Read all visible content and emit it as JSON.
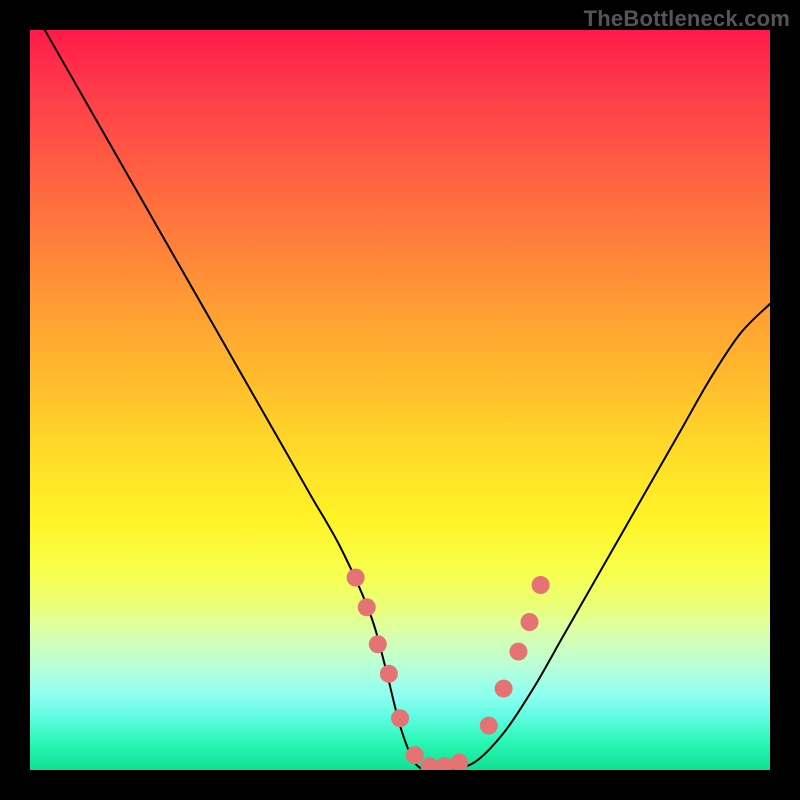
{
  "watermark": "TheBottleneck.com",
  "colors": {
    "curve_stroke": "#000000",
    "marker_fill": "#e57373",
    "marker_stroke": "#d46060",
    "background_outer": "#000000"
  },
  "chart_data": {
    "type": "line",
    "title": "",
    "xlabel": "",
    "ylabel": "",
    "xlim": [
      0,
      100
    ],
    "ylim": [
      0,
      100
    ],
    "grid": false,
    "legend": false,
    "series": [
      {
        "name": "bottleneck-curve",
        "x": [
          2,
          6,
          10,
          14,
          18,
          22,
          26,
          30,
          34,
          38,
          42,
          46,
          48,
          50,
          52,
          54,
          56,
          60,
          64,
          68,
          72,
          76,
          80,
          84,
          88,
          92,
          96,
          100
        ],
        "y": [
          100,
          93,
          86,
          79,
          72,
          65,
          58,
          51,
          44,
          37,
          30,
          21,
          14,
          6,
          1,
          0,
          0,
          1,
          5,
          11,
          18,
          25,
          32,
          39,
          46,
          53,
          59,
          63
        ]
      }
    ],
    "markers": {
      "name": "highlighted-points",
      "x": [
        44,
        45.5,
        47,
        48.5,
        50,
        52,
        54,
        56,
        58,
        62,
        64,
        66,
        67.5,
        69
      ],
      "y": [
        26,
        22,
        17,
        13,
        7,
        2,
        0.5,
        0.5,
        1,
        6,
        11,
        16,
        20,
        25
      ]
    }
  }
}
